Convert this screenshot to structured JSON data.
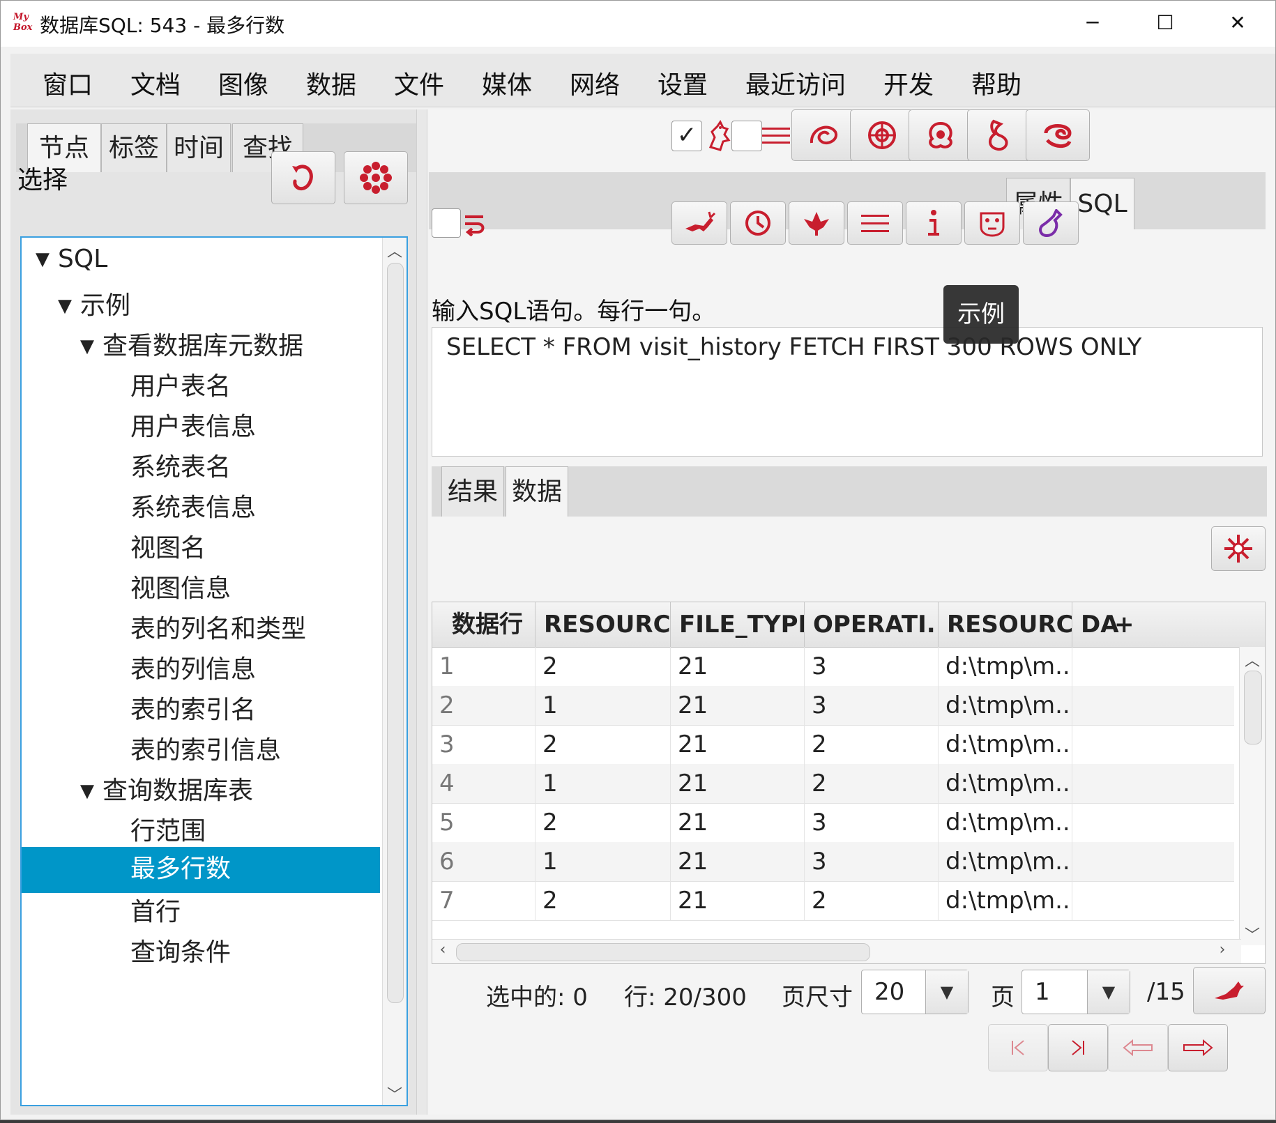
{
  "window": {
    "title": "数据库SQL: 543 - 最多行数",
    "logo_top": "My",
    "logo_bottom": "Box",
    "minimize": "─",
    "maximize": "☐",
    "close": "✕"
  },
  "menu": [
    "窗口",
    "文档",
    "图像",
    "数据",
    "文件",
    "媒体",
    "网络",
    "设置",
    "最近访问",
    "开发",
    "帮助"
  ],
  "left": {
    "tabs": [
      "节点",
      "标签",
      "时间",
      "查找"
    ],
    "active_tab": "节点",
    "select_label": "选择",
    "tree": [
      {
        "label": "SQL",
        "level": 0,
        "expanded": true
      },
      {
        "label": "示例",
        "level": 1,
        "expanded": true
      },
      {
        "label": "查看数据库元数据",
        "level": 2,
        "expanded": true
      },
      {
        "label": "用户表名",
        "level": 3
      },
      {
        "label": "用户表信息",
        "level": 3
      },
      {
        "label": "系统表名",
        "level": 3
      },
      {
        "label": "系统表信息",
        "level": 3
      },
      {
        "label": "视图名",
        "level": 3
      },
      {
        "label": "视图信息",
        "level": 3
      },
      {
        "label": "表的列名和类型",
        "level": 3
      },
      {
        "label": "表的列信息",
        "level": 3
      },
      {
        "label": "表的索引名",
        "level": 3
      },
      {
        "label": "表的索引信息",
        "level": 3
      },
      {
        "label": "查询数据库表",
        "level": 2,
        "expanded": true
      },
      {
        "label": "行范围",
        "level": 3
      },
      {
        "label": "最多行数",
        "level": 3,
        "selected": true
      },
      {
        "label": "首行",
        "level": 3
      },
      {
        "label": "查询条件",
        "level": 3
      }
    ]
  },
  "right": {
    "tabs": [
      "属性",
      "SQL"
    ],
    "active_tab": "SQL",
    "prompt": "输入SQL语句。每行一句。",
    "sql_text": "SELECT * FROM visit_history FETCH FIRST 300 ROWS ONLY",
    "tooltip": "示例",
    "result_tabs": [
      "结果",
      "数据"
    ],
    "active_result_tab": "数据",
    "table": {
      "columns": [
        "数据行",
        "RESOURC...",
        "FILE_TYPE",
        "OPERATI...",
        "RESOURC...",
        "DA"
      ],
      "add_column": "+",
      "rows": [
        [
          "1",
          "2",
          "21",
          "3",
          "d:\\tmp\\m..."
        ],
        [
          "2",
          "1",
          "21",
          "3",
          "d:\\tmp\\m..."
        ],
        [
          "3",
          "2",
          "21",
          "2",
          "d:\\tmp\\m..."
        ],
        [
          "4",
          "1",
          "21",
          "2",
          "d:\\tmp\\m..."
        ],
        [
          "5",
          "2",
          "21",
          "3",
          "d:\\tmp\\m..."
        ],
        [
          "6",
          "1",
          "21",
          "3",
          "d:\\tmp\\m..."
        ],
        [
          "7",
          "2",
          "21",
          "2",
          "d:\\tmp\\m..."
        ]
      ]
    },
    "status": {
      "selected": "选中的: 0",
      "rows": "行: 20/300",
      "page_size_label": "页尺寸",
      "page_size": "20",
      "page_label": "页",
      "page": "1",
      "page_total": "/15"
    }
  },
  "colors": {
    "accent": "#c81e2e",
    "selection": "#0096c8",
    "focus_border": "#3aa0e0"
  }
}
